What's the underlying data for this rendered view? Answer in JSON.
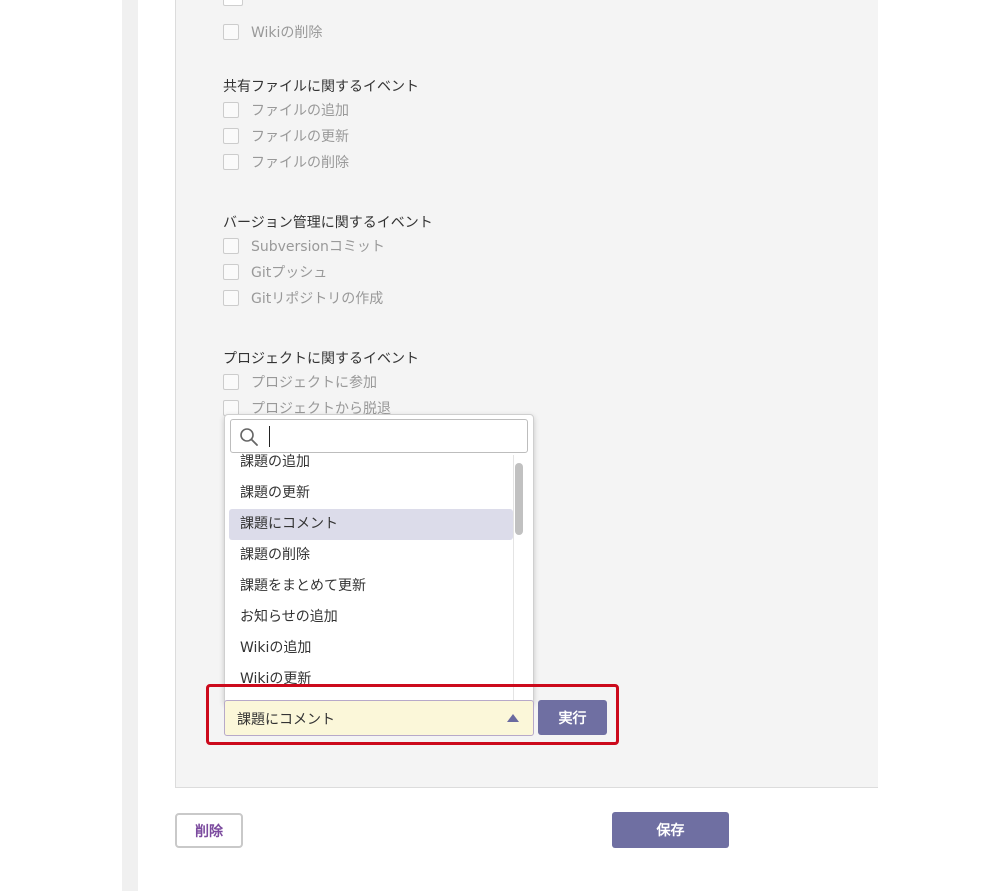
{
  "sections": [
    {
      "title": "",
      "items": [
        "Wikiの削除"
      ]
    },
    {
      "title": "共有ファイルに関するイベント",
      "items": [
        "ファイルの追加",
        "ファイルの更新",
        "ファイルの削除"
      ]
    },
    {
      "title": "バージョン管理に関するイベント",
      "items": [
        "Subversionコミット",
        "Gitプッシュ",
        "Gitリポジトリの作成"
      ]
    },
    {
      "title": "プロジェクトに関するイベント",
      "items": [
        "プロジェクトに参加",
        "プロジェクトから脱退"
      ]
    }
  ],
  "dropdown": {
    "search_value": "",
    "icon": "search-icon",
    "options": [
      "課題の追加",
      "課題の更新",
      "課題にコメント",
      "課題の削除",
      "課題をまとめて更新",
      "お知らせの追加",
      "Wikiの追加",
      "Wikiの更新"
    ],
    "highlighted": "課題にコメント"
  },
  "select": {
    "value": "課題にコメント",
    "icon": "caret-up-icon"
  },
  "buttons": {
    "execute": "実行",
    "delete": "削除",
    "save": "保存"
  },
  "colors": {
    "accent": "#6f6fa2",
    "highlight_border": "#cc0a1c",
    "select_bg": "#fbf7d9",
    "option_highlight": "#dcdcea"
  }
}
